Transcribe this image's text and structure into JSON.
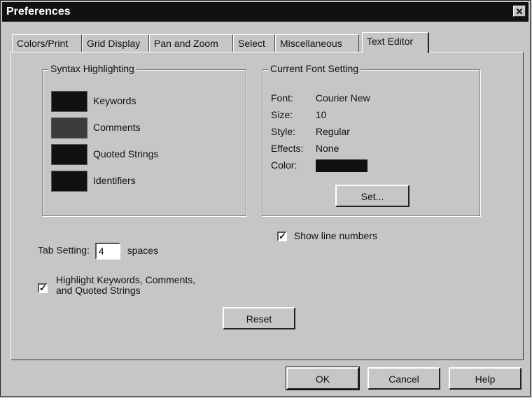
{
  "window": {
    "title": "Preferences",
    "close_glyph": "✕"
  },
  "tabs": [
    {
      "label": "Colors/Print"
    },
    {
      "label": "Grid Display"
    },
    {
      "label": "Pan and Zoom"
    },
    {
      "label": "Select"
    },
    {
      "label": "Miscellaneous"
    },
    {
      "label": "Text Editor",
      "active": true
    }
  ],
  "syntax": {
    "legend": "Syntax Highlighting",
    "items": [
      {
        "label": "Keywords",
        "color": "#111111"
      },
      {
        "label": "Comments",
        "color": "#3c3c3c"
      },
      {
        "label": "Quoted Strings",
        "color": "#111111"
      },
      {
        "label": "Identifiers",
        "color": "#111111"
      }
    ]
  },
  "font": {
    "legend": "Current Font Setting",
    "rows": [
      {
        "key": "Font:",
        "value": "Courier New"
      },
      {
        "key": "Size:",
        "value": "10"
      },
      {
        "key": "Style:",
        "value": "Regular"
      },
      {
        "key": "Effects:",
        "value": "None"
      },
      {
        "key": "Color:",
        "value": ""
      }
    ],
    "set_label": "Set..."
  },
  "show_line_numbers": {
    "label": "Show line numbers",
    "checked": true
  },
  "tab_setting": {
    "label": "Tab Setting:",
    "value": "4",
    "suffix": "spaces"
  },
  "highlight": {
    "label_line1": "Highlight Keywords, Comments,",
    "label_line2": "and Quoted Strings",
    "checked": true
  },
  "reset_label": "Reset",
  "footer": {
    "ok": "OK",
    "cancel": "Cancel",
    "help": "Help"
  }
}
